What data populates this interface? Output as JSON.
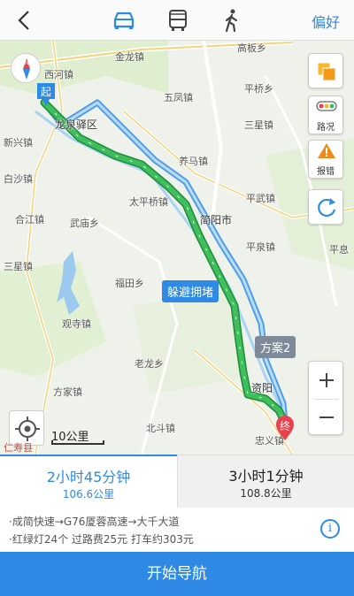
{
  "header": {
    "preference_label": "偏好",
    "modes": [
      {
        "name": "car",
        "icon": "car-icon",
        "selected": true
      },
      {
        "name": "bus",
        "icon": "bus-icon",
        "selected": false
      },
      {
        "name": "walk",
        "icon": "walk-icon",
        "selected": false
      }
    ],
    "accent_color": "#2f8ae5"
  },
  "map": {
    "places": [
      "金龙镇",
      "高板乡",
      "西河镇",
      "五凤镇",
      "平桥乡",
      "龙泉驿区",
      "三星镇",
      "新兴镇",
      "养马镇",
      "白沙镇",
      "平武镇",
      "太平桥镇",
      "简阳市",
      "合江镇",
      "武庙乡",
      "平泉镇",
      "平息",
      "三星镇",
      "福田乡",
      "观寺镇",
      "老龙乡",
      "方家镇",
      "资阳",
      "北斗镇",
      "忠义镇"
    ],
    "start_label": "起",
    "end_label": "终",
    "congestion_bubble": "躲避拥堵",
    "alt_route_bubble": "方案2",
    "scale_label": "10公里",
    "watermark": "仁寿县",
    "controls": {
      "traffic_label": "路况",
      "report_label": "报错"
    }
  },
  "routes": [
    {
      "time": "2小时45分钟",
      "distance": "106.6公里",
      "selected": true
    },
    {
      "time": "3小时1分钟",
      "distance": "108.8公里",
      "selected": false
    }
  ],
  "route_info": {
    "roads": "·成简快速→G76厦蓉高速→大千大道",
    "stats": "·红绿灯24个   过路费25元   打车约303元"
  },
  "start_button": "开始导航"
}
